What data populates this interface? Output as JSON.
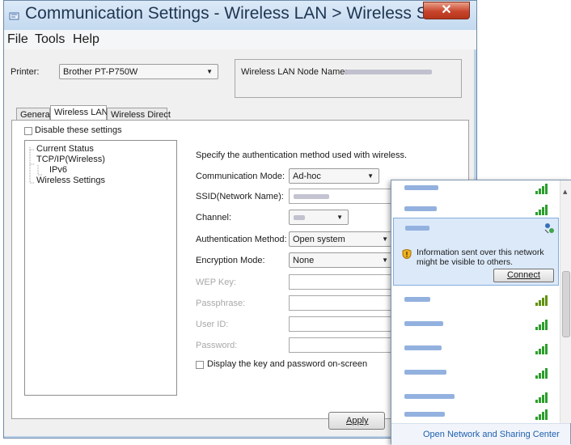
{
  "window": {
    "title": "Communication Settings - Wireless LAN > Wireless Setti...",
    "close_glyph": "✕"
  },
  "menu": {
    "file": "File",
    "tools": "Tools",
    "help": "Help"
  },
  "printer": {
    "label": "Printer:",
    "selected": "Brother PT-P750W",
    "node_name_label": "Wireless LAN Node Name:"
  },
  "tabs": {
    "general": "General",
    "wireless_lan": "Wireless LAN",
    "wireless_direct": "Wireless Direct"
  },
  "disable_checkbox": {
    "label": "Disable these settings",
    "checked": false
  },
  "tree": {
    "current_status": "Current Status",
    "tcpip": "TCP/IP(Wireless)",
    "ipv6": "IPv6",
    "wireless_settings": "Wireless Settings"
  },
  "form": {
    "description": "Specify the authentication method used with wireless.",
    "comm_mode_label": "Communication Mode:",
    "comm_mode_value": "Ad-hoc",
    "ssid_label": "SSID(Network Name):",
    "channel_label": "Channel:",
    "auth_label": "Authentication Method:",
    "auth_value": "Open system",
    "encryption_label": "Encryption Mode:",
    "encryption_value": "None",
    "wep_label": "WEP Key:",
    "passphrase_label": "Passphrase:",
    "userid_label": "User ID:",
    "password_label": "Password:",
    "display_key_label": "Display the key and password on-screen"
  },
  "buttons": {
    "apply": "Apply"
  },
  "flyout": {
    "warning": "Information sent over this network might be visible to others.",
    "connect": "Connect",
    "footer_link": "Open Network and Sharing Center",
    "networks_count_visible": 10
  },
  "colors": {
    "titlebar": "#c3d9ef",
    "close": "#c8452d",
    "signal": "#2e9e2e",
    "link": "#1f5fae"
  }
}
